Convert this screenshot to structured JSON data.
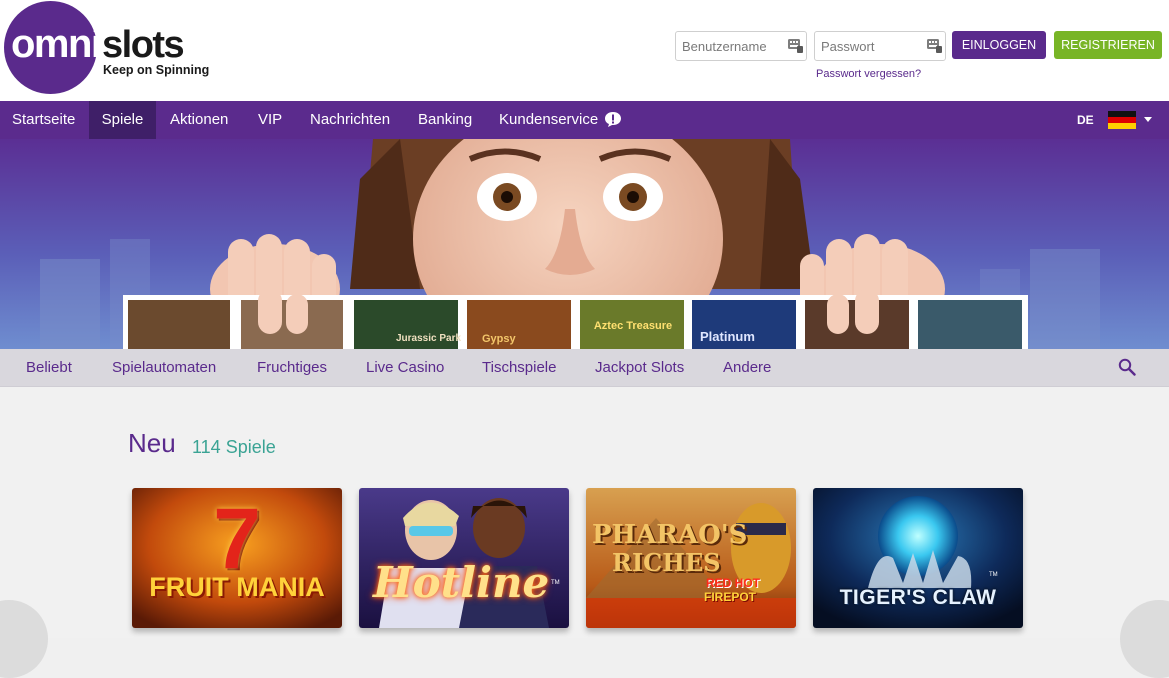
{
  "brand": {
    "logo_omni": "omni",
    "logo_slots": "slots",
    "tagline": "Keep on Spinning",
    "purple": "#5a2a8c",
    "green": "#78b526"
  },
  "login": {
    "username_placeholder": "Benutzername",
    "password_placeholder": "Passwort",
    "login_label": "EINLOGGEN",
    "register_label": "REGISTRIEREN",
    "forgot_label": "Passwort vergessen?"
  },
  "nav": {
    "items": [
      "Startseite",
      "Spiele",
      "Aktionen",
      "VIP",
      "Nachrichten",
      "Banking",
      "Kundenservice"
    ],
    "active": "Spiele",
    "lang": "DE"
  },
  "banner": {
    "game_thumbs": [
      "Jurassic Park",
      "Gypsy",
      "Aztec Treasure",
      "Platinum"
    ]
  },
  "categories": {
    "items": [
      "Beliebt",
      "Spielautomaten",
      "Fruchtiges",
      "Live Casino",
      "Tischspiele",
      "Jackpot Slots",
      "Andere"
    ]
  },
  "section": {
    "title": "Neu",
    "count": "114 Spiele"
  },
  "games": [
    {
      "line1": "7",
      "line2": "FRUIT MANIA"
    },
    {
      "line1": "Hotline",
      "line2": "TM"
    },
    {
      "line1": "PHARAO'S",
      "line2": "RICHES",
      "line3": "RED HOT",
      "line4": "FIREPOT"
    },
    {
      "line1": "TIGER'S CLAW",
      "line2": "TM"
    }
  ]
}
